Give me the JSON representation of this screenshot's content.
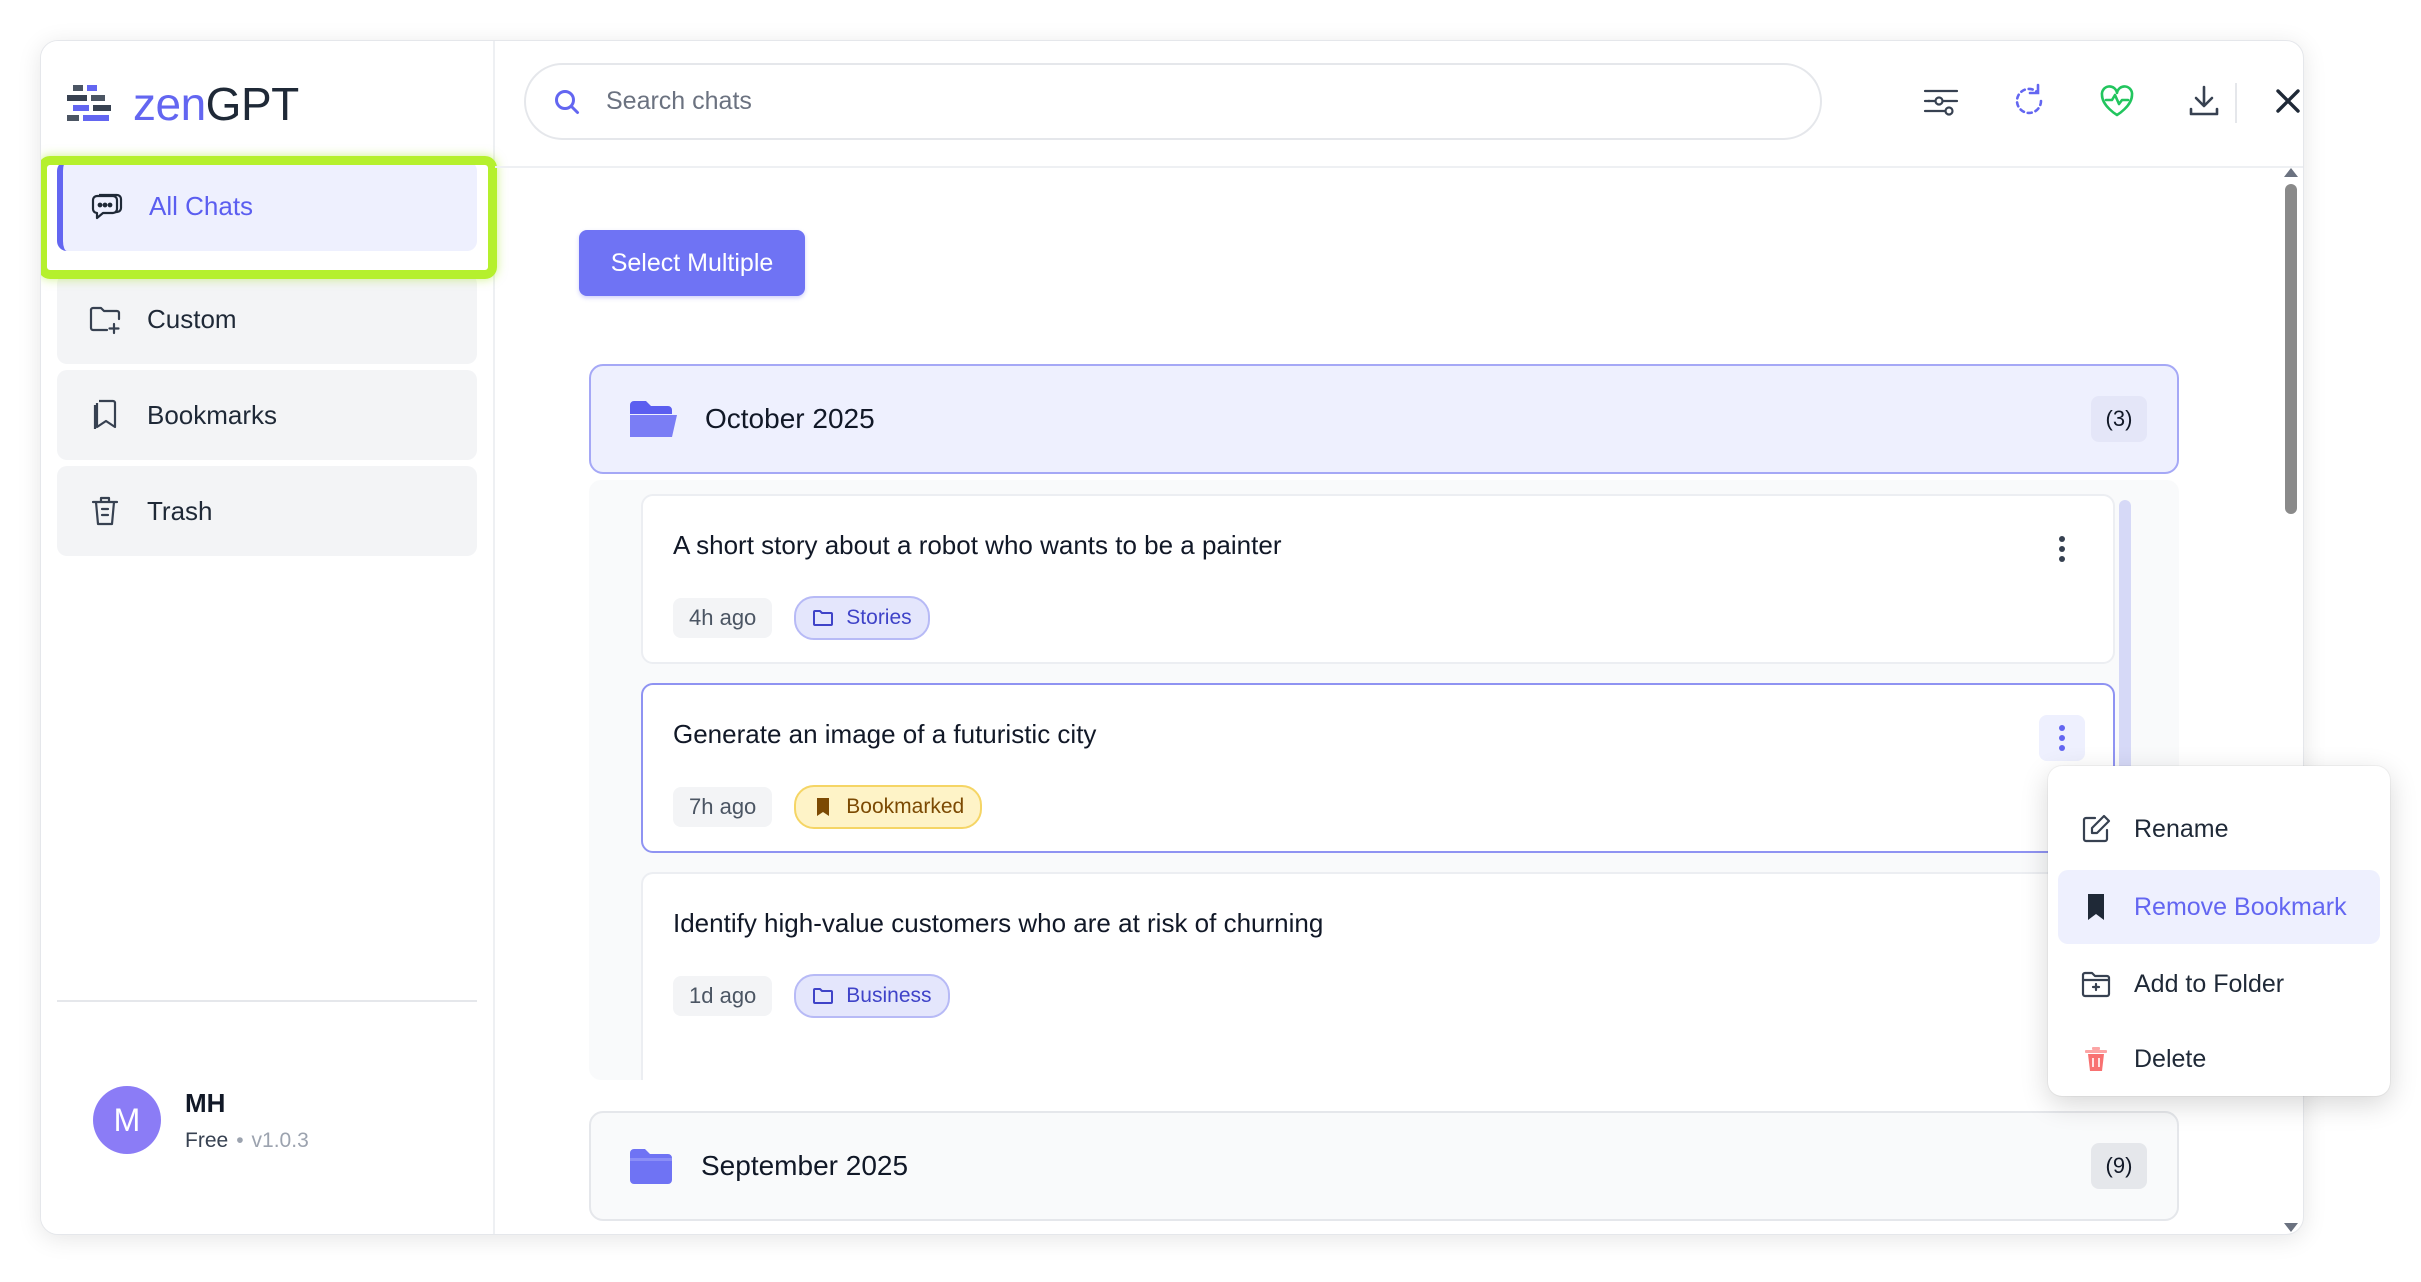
{
  "app": {
    "logo_prefix": "zen",
    "logo_suffix": "GPT"
  },
  "sidebar": {
    "items": [
      {
        "label": "All Chats",
        "icon": "chats-icon",
        "active": true
      },
      {
        "label": "Custom",
        "icon": "folder-plus-icon"
      },
      {
        "label": "Bookmarks",
        "icon": "bookmark-icon"
      },
      {
        "label": "Trash",
        "icon": "trash-icon"
      }
    ]
  },
  "user": {
    "initial": "M",
    "name": "MH",
    "plan": "Free",
    "separator": "•",
    "version": "v1.0.3"
  },
  "search": {
    "placeholder": "Search chats",
    "value": ""
  },
  "toolbar": {
    "icons": [
      "filter-icon",
      "sync-icon",
      "health-icon",
      "download-icon",
      "close-icon"
    ]
  },
  "actions": {
    "select_multiple": "Select Multiple"
  },
  "groups": [
    {
      "title": "October 2025",
      "count": "(3)",
      "chats": [
        {
          "title": "A short story about a robot who wants to be a painter",
          "time": "4h ago",
          "tag": "Stories",
          "tag_type": "folder"
        },
        {
          "title": "Generate an image of a futuristic city",
          "time": "7h ago",
          "tag": "Bookmarked",
          "tag_type": "bookmark"
        },
        {
          "title": "Identify high-value customers who are at risk of churning",
          "time": "1d ago",
          "tag": "Business",
          "tag_type": "folder"
        }
      ]
    },
    {
      "title": "September 2025",
      "count": "(9)"
    }
  ],
  "context_menu": {
    "items": [
      {
        "label": "Rename",
        "icon": "edit-icon"
      },
      {
        "label": "Remove Bookmark",
        "icon": "bookmark-filled-icon",
        "active": true
      },
      {
        "label": "Add to Folder",
        "icon": "folder-add-icon"
      },
      {
        "label": "Delete",
        "icon": "trash-icon"
      }
    ]
  },
  "colors": {
    "accent": "#6366f1",
    "highlight": "#b5f02d",
    "bookmark_chip": "#fef3c7",
    "folder_chip": "#e4e6fc",
    "health": "#22c55e",
    "delete": "#f87171"
  }
}
